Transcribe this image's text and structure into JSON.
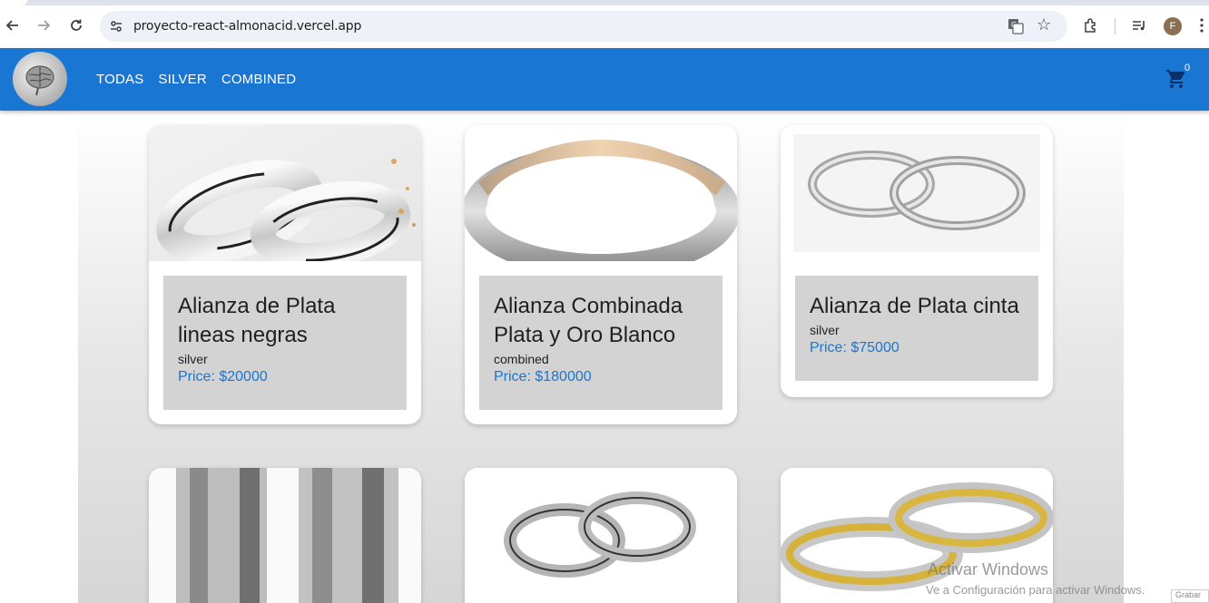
{
  "browser": {
    "url": "proyecto-react-almonacid.vercel.app",
    "profile_initial": "F"
  },
  "navbar": {
    "links": [
      "TODAS",
      "SILVER",
      "COMBINED"
    ],
    "cart_count": "0",
    "colors": {
      "primary": "#1976d2",
      "price": "#1976d2",
      "info_bg": "#d3d3d3"
    }
  },
  "products": [
    {
      "name": "Alianza de Plata lineas negras",
      "category": "silver",
      "price": "Price: $20000"
    },
    {
      "name": "Alianza Combinada Plata y Oro Blanco",
      "category": "combined",
      "price": "Price: $180000"
    },
    {
      "name": "Alianza de Plata cinta",
      "category": "silver",
      "price": "Price: $75000"
    }
  ],
  "watermark": {
    "line1": "Activar Windows",
    "line2": "Ve a Configuración para activar Windows."
  },
  "recording_chip": "Grabar"
}
